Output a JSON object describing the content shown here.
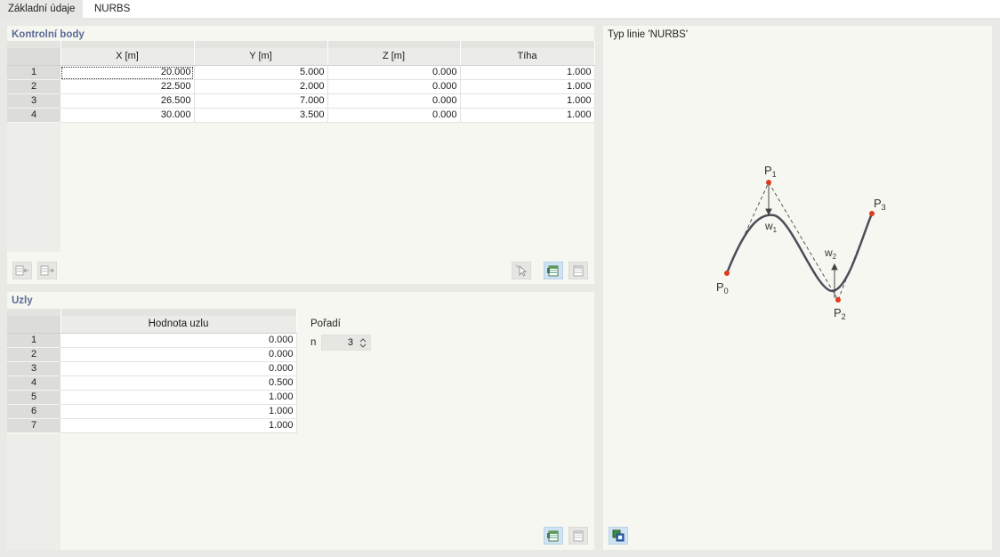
{
  "tabs": [
    {
      "label": "Základní údaje"
    },
    {
      "label": "NURBS"
    }
  ],
  "control_points": {
    "title": "Kontrolní body",
    "columns": [
      "X [m]",
      "Y [m]",
      "Z [m]",
      "Tíha"
    ],
    "rows": [
      {
        "num": "1",
        "x": "20.000",
        "y": "5.000",
        "z": "0.000",
        "w": "1.000"
      },
      {
        "num": "2",
        "x": "22.500",
        "y": "2.000",
        "z": "0.000",
        "w": "1.000"
      },
      {
        "num": "3",
        "x": "26.500",
        "y": "7.000",
        "z": "0.000",
        "w": "1.000"
      },
      {
        "num": "4",
        "x": "30.000",
        "y": "3.500",
        "z": "0.000",
        "w": "1.000"
      }
    ],
    "toolbar_icons": [
      "insert-row-icon",
      "delete-row-icon",
      "pick-point-icon",
      "import-table-icon",
      "export-table-icon"
    ]
  },
  "knots": {
    "title": "Uzly",
    "column": "Hodnota uzlu",
    "rows": [
      {
        "num": "1",
        "value": "0.000"
      },
      {
        "num": "2",
        "value": "0.000"
      },
      {
        "num": "3",
        "value": "0.000"
      },
      {
        "num": "4",
        "value": "0.500"
      },
      {
        "num": "5",
        "value": "1.000"
      },
      {
        "num": "6",
        "value": "1.000"
      },
      {
        "num": "7",
        "value": "1.000"
      }
    ],
    "order_label": "Pořadí",
    "n_label": "n",
    "n_value": "3"
  },
  "preview": {
    "title": "Typ linie 'NURBS'",
    "labels": {
      "p0": "P",
      "p1": "P",
      "p2": "P",
      "p3": "P",
      "w1": "w",
      "w2": "w"
    },
    "subscripts": {
      "p0": "0",
      "p1": "1",
      "p2": "2",
      "p3": "3",
      "w1": "1",
      "w2": "2"
    },
    "colors": {
      "curve": "#4d4d5a",
      "point": "#e0391d",
      "dashed": "#555555"
    }
  }
}
